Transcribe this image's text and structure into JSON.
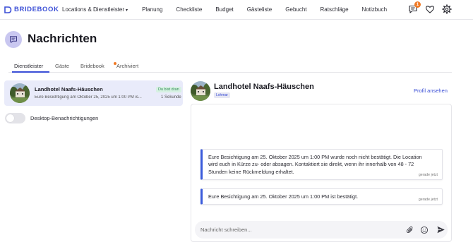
{
  "brand": {
    "name": "BRIDEBOOK",
    "color": "#3b4fd6"
  },
  "nav": {
    "items": [
      {
        "label": "Locations & Dienstleister",
        "has_dropdown": true
      },
      {
        "label": "Planung"
      },
      {
        "label": "Checkliste"
      },
      {
        "label": "Budget"
      },
      {
        "label": "Gästeliste"
      },
      {
        "label": "Gebucht"
      },
      {
        "label": "Ratschläge"
      },
      {
        "label": "Notizbuch"
      }
    ],
    "dropdown_caret": "▾",
    "icons": [
      {
        "name": "messages-icon",
        "badge": "1"
      },
      {
        "name": "heart-icon"
      },
      {
        "name": "settings-gear-icon"
      }
    ]
  },
  "page": {
    "title": "Nachrichten",
    "icon": "chat-bubble-icon"
  },
  "tabs": [
    {
      "label": "Dienstleister",
      "active": true
    },
    {
      "label": "Gäste"
    },
    {
      "label": "Bridebook",
      "notification_dot": true
    },
    {
      "label": "Archiviert"
    }
  ],
  "conversations": [
    {
      "name": "Landhotel Naafs-Häuschen",
      "preview": "Eure Besichtigung am Oktober 25, 2025 um 1:00 PM is...",
      "status": "Du bist dran",
      "time": "1 Sekunde",
      "selected": true
    }
  ],
  "desktop_notifications": {
    "label": "Desktop-Benachrichtigungen",
    "enabled": false
  },
  "chat": {
    "title": "Landhotel Naafs-Häuschen",
    "tag": "Lohmar",
    "profile_link": "Profil ansehen",
    "messages": [
      {
        "text": "Eure Besichtigung am 25. Oktober 2025 um 1:00 PM wurde noch nicht bestätigt. Die Location wird euch in Kürze zu- oder absagen. Kontaktiert sie direkt, wenn ihr innerhalb von 48 - 72 Stunden keine Rückmeldung erhaltet.",
        "time": "gerade jetzt"
      },
      {
        "text": "Eure Besichtigung am 25. Oktober 2025 um 1:00 PM ist bestätigt.",
        "time": "gerade jetzt"
      }
    ],
    "composer_placeholder": "Nachricht schreiben...",
    "composer_icons": [
      "paperclip-icon",
      "emoji-icon",
      "send-icon"
    ]
  },
  "colors": {
    "accent": "#3b4fd6",
    "notification": "#f07a25",
    "selected_bg": "#e9ebfa",
    "status_bg": "#d6f1e2",
    "status_text": "#2f8a55"
  }
}
